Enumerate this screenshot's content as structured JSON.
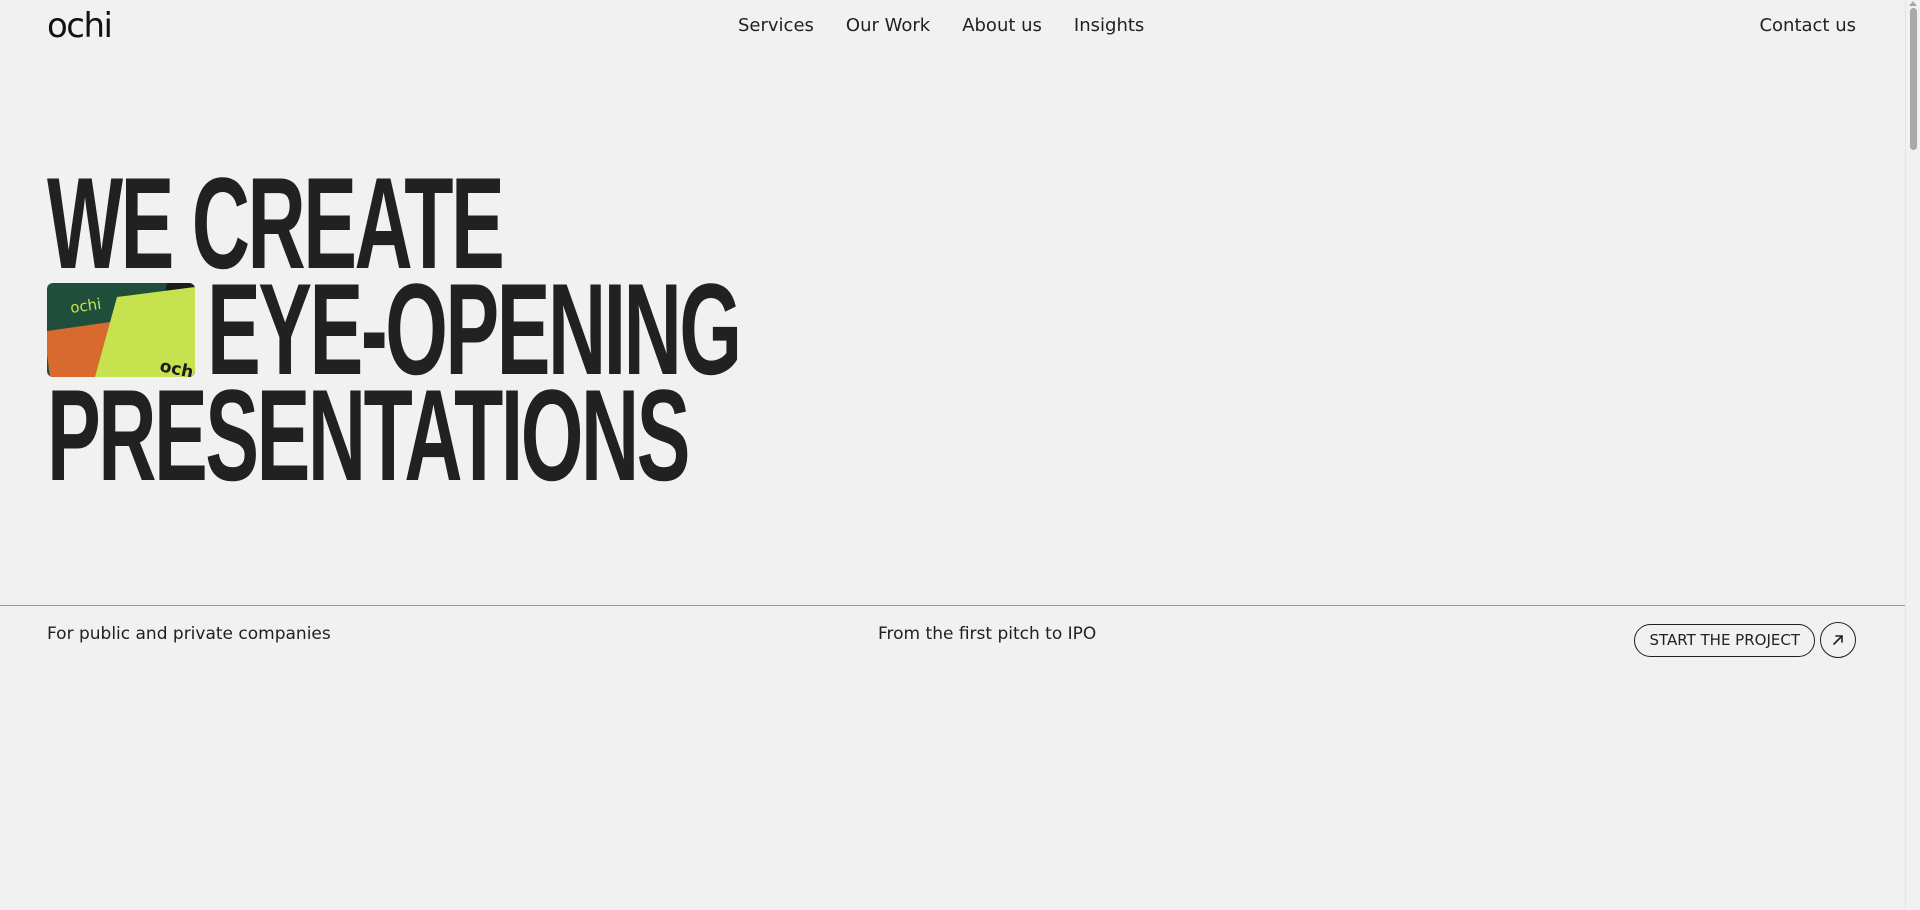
{
  "brand": {
    "logo_text": "ochi"
  },
  "nav": {
    "links": [
      "Services",
      "Our Work",
      "About us",
      "Insights"
    ],
    "contact_label": "Contact us"
  },
  "hero": {
    "line1": "WE CREATE",
    "line2": "EYE-OPENING",
    "line3": "PRESENTATIONS",
    "thumb_logo_top": "ochi",
    "thumb_logo_bottom": "ochi",
    "thumb_colors": {
      "dark_green": "#1f4f3a",
      "lime": "#c6e34f",
      "orange": "#d8692f",
      "dark": "#1c1c1c"
    }
  },
  "tagline": {
    "left": "For public and private companies",
    "middle": "From the first pitch to IPO"
  },
  "cta": {
    "label": "START THE PROJECT",
    "arrow_icon": "arrow-up-right-icon"
  },
  "colors": {
    "background": "#f1f1f1",
    "text": "#212121",
    "divider": "#9a9a9a"
  }
}
